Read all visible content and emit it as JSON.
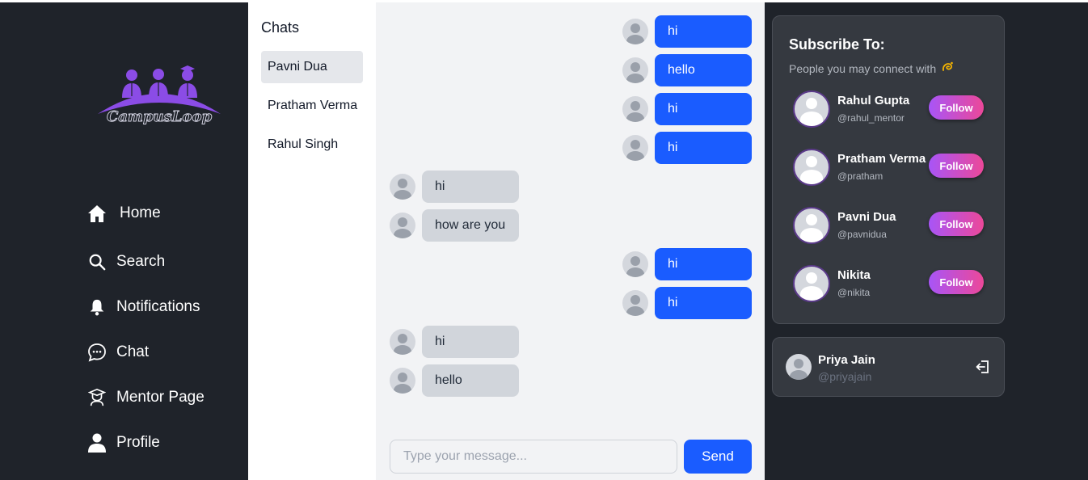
{
  "nav": {
    "logo_text": "CampusLoop",
    "items": [
      {
        "label": "Home",
        "icon": "home-icon"
      },
      {
        "label": "Search",
        "icon": "search-icon"
      },
      {
        "label": "Notifications",
        "icon": "bell-icon"
      },
      {
        "label": "Chat",
        "icon": "chat-bubble-icon"
      },
      {
        "label": "Mentor Page",
        "icon": "mentor-icon"
      },
      {
        "label": "Profile",
        "icon": "user-icon"
      }
    ]
  },
  "chats": {
    "title": "Chats",
    "contacts": [
      {
        "name": "Pavni Dua",
        "active": true
      },
      {
        "name": "Pratham Verma",
        "active": false
      },
      {
        "name": "Rahul Singh",
        "active": false
      }
    ]
  },
  "conversation": {
    "messages": [
      {
        "text": "hi",
        "direction": "out"
      },
      {
        "text": "hello",
        "direction": "out"
      },
      {
        "text": "hi",
        "direction": "out"
      },
      {
        "text": "hi",
        "direction": "out"
      },
      {
        "text": "hi",
        "direction": "in"
      },
      {
        "text": "how are you",
        "direction": "in"
      },
      {
        "text": "hi",
        "direction": "out"
      },
      {
        "text": "hi",
        "direction": "out"
      },
      {
        "text": "hi",
        "direction": "in"
      },
      {
        "text": "hello",
        "direction": "in"
      }
    ],
    "input_placeholder": "Type your message...",
    "send_label": "Send"
  },
  "suggestions": {
    "title": "Subscribe To:",
    "subtitle": "People you may connect with",
    "subtitle_icon": "dizzy-emoji-icon",
    "people": [
      {
        "name": "Rahul Gupta",
        "handle": "@rahul_mentor",
        "button": "Follow"
      },
      {
        "name": "Pratham Verma",
        "handle": "@pratham",
        "button": "Follow"
      },
      {
        "name": "Pavni Dua",
        "handle": "@pavnidua",
        "button": "Follow"
      },
      {
        "name": "Nikita",
        "handle": "@nikita",
        "button": "Follow"
      }
    ]
  },
  "current_user": {
    "name": "Priya Jain",
    "handle": "@priyajain",
    "logout_icon": "logout-icon"
  },
  "colors": {
    "sidebar_bg": "#1f232a",
    "outgoing_bubble": "#1a5cff",
    "incoming_bubble": "#d1d5db",
    "follow_gradient_start": "#a855f7",
    "follow_gradient_end": "#ec4899",
    "logo_purple": "#8b4ce6"
  }
}
